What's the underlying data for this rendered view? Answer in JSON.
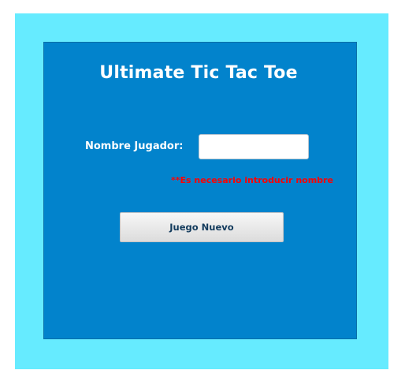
{
  "app": {
    "title": "Ultimate Tic Tac Toe"
  },
  "form": {
    "name_label": "Nombre Jugador:",
    "name_value": "",
    "error_text": "**Es necesario introducir nombre",
    "new_game_label": "Juego Nuevo"
  },
  "colors": {
    "outer_background": "#66ebff",
    "panel_background": "#0283cc",
    "error": "#ff0000"
  }
}
